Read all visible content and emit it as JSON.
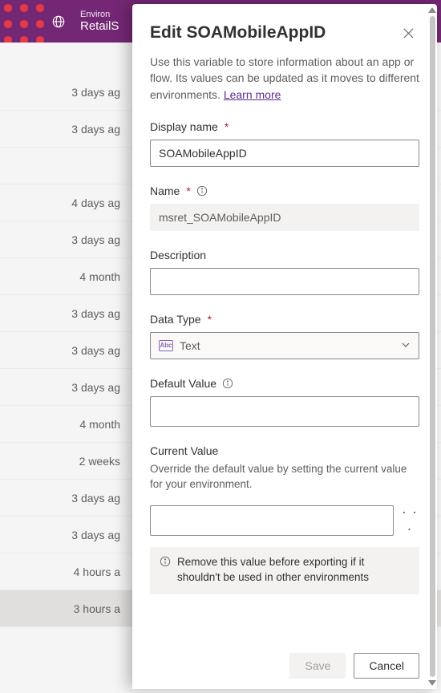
{
  "header": {
    "env_label": "Environ",
    "env_name": "RetailS"
  },
  "bg_rows": [
    "3 days ag",
    "3 days ag",
    "",
    "4 days ag",
    "3 days ag",
    "4 month",
    "3 days ag",
    "3 days ag",
    "3 days ag",
    "4 month",
    "2 weeks",
    "3 days ag",
    "3 days ag",
    "4 hours a",
    "3 hours a"
  ],
  "panel": {
    "title": "Edit SOAMobileAppID",
    "desc": "Use this variable to store information about an app or flow. Its values can be updated as it moves to different environments.",
    "learn_more": "Learn more",
    "display_name_label": "Display name",
    "display_name_value": "SOAMobileAppID",
    "name_label": "Name",
    "name_value": "msret_SOAMobileAppID",
    "description_label": "Description",
    "description_value": "",
    "data_type_label": "Data Type",
    "data_type_value": "Text",
    "data_type_icon_text": "Abc",
    "default_value_label": "Default Value",
    "default_value_value": "",
    "current_value_label": "Current Value",
    "current_value_sub": "Override the default value by setting the current value for your environment.",
    "current_value_value": "",
    "notice": "Remove this value before exporting if it shouldn't be used in other environments",
    "save": "Save",
    "cancel": "Cancel"
  }
}
